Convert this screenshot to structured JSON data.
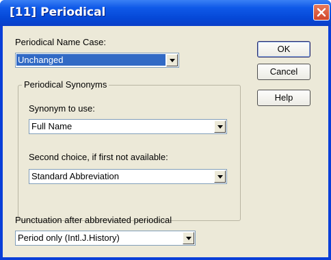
{
  "window": {
    "title": "[11] Periodical"
  },
  "name_case": {
    "label": "Periodical Name Case:",
    "value": "Unchanged"
  },
  "synonyms": {
    "group_title": "Periodical Synonyms",
    "synonym_label": "Synonym to use:",
    "synonym_value": "Full Name",
    "second_label": "Second choice, if first not available:",
    "second_value": "Standard Abbreviation"
  },
  "punctuation": {
    "label": "Punctuation after abbreviated periodical",
    "value": "Period only (Intl.J.History)"
  },
  "buttons": {
    "ok": "OK",
    "cancel": "Cancel",
    "help": "Help"
  },
  "colors": {
    "titlebar": "#0548d7",
    "dialog_bg": "#ece9d8",
    "selection": "#316ac5",
    "close": "#d2462a"
  },
  "icons": {
    "close": "close-x-icon",
    "dropdown": "chevron-down-icon"
  }
}
